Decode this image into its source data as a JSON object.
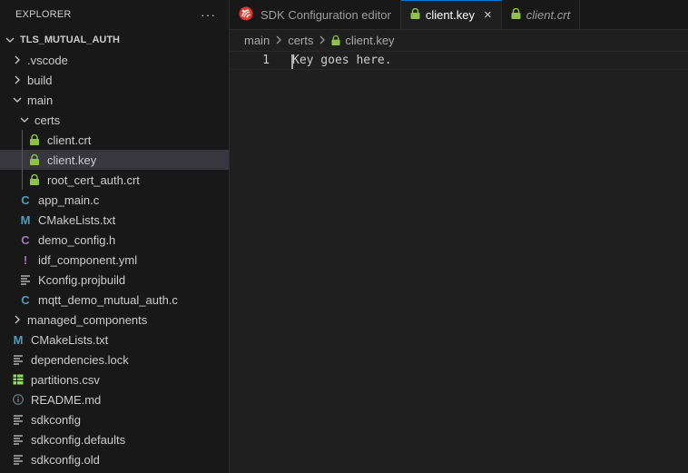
{
  "sidebar": {
    "title": "EXPLORER",
    "more": "···",
    "project": "TLS_MUTUAL_AUTH",
    "items": [
      {
        "label": ".vscode",
        "type": "folder",
        "open": false,
        "depth": 1
      },
      {
        "label": "build",
        "type": "folder",
        "open": false,
        "depth": 1
      },
      {
        "label": "main",
        "type": "folder",
        "open": true,
        "depth": 1
      },
      {
        "label": "certs",
        "type": "folder",
        "open": true,
        "depth": 2
      },
      {
        "label": "client.crt",
        "type": "lock",
        "depth": 3
      },
      {
        "label": "client.key",
        "type": "lock",
        "depth": 3,
        "selected": true
      },
      {
        "label": "root_cert_auth.crt",
        "type": "lock",
        "depth": 3
      },
      {
        "label": "app_main.c",
        "type": "c",
        "depth": 2
      },
      {
        "label": "CMakeLists.txt",
        "type": "cmake",
        "depth": 2
      },
      {
        "label": "demo_config.h",
        "type": "h",
        "depth": 2
      },
      {
        "label": "idf_component.yml",
        "type": "yml",
        "depth": 2
      },
      {
        "label": "Kconfig.projbuild",
        "type": "lines",
        "depth": 2
      },
      {
        "label": "mqtt_demo_mutual_auth.c",
        "type": "c",
        "depth": 2
      },
      {
        "label": "managed_components",
        "type": "folder",
        "open": false,
        "depth": 1
      },
      {
        "label": "CMakeLists.txt",
        "type": "cmake",
        "depth": 1
      },
      {
        "label": "dependencies.lock",
        "type": "lines",
        "depth": 1
      },
      {
        "label": "partitions.csv",
        "type": "csv",
        "depth": 1
      },
      {
        "label": "README.md",
        "type": "info",
        "depth": 1
      },
      {
        "label": "sdkconfig",
        "type": "lines",
        "depth": 1
      },
      {
        "label": "sdkconfig.defaults",
        "type": "lines",
        "depth": 1
      },
      {
        "label": "sdkconfig.old",
        "type": "lines",
        "depth": 1
      }
    ]
  },
  "tabs": [
    {
      "label": "SDK Configuration editor",
      "icon": "espressif-icon",
      "active": false,
      "italic": false
    },
    {
      "label": "client.key",
      "icon": "lock-icon",
      "active": true,
      "italic": false,
      "close": "×"
    },
    {
      "label": "client.crt",
      "icon": "lock-icon",
      "active": false,
      "italic": true
    }
  ],
  "breadcrumbs": [
    "main",
    "certs",
    "client.key"
  ],
  "editor": {
    "lines": [
      {
        "num": "1",
        "text": "Key goes here."
      }
    ]
  },
  "colors": {
    "lock": "#8dc149",
    "c_file": "#519aba",
    "h_file": "#a074c4",
    "yml": "#cbcb41",
    "espressif": "#e7352c",
    "accent": "#0078d4"
  }
}
